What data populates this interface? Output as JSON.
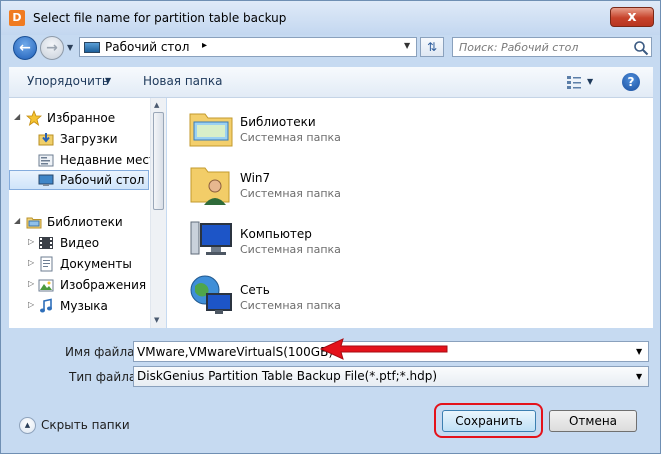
{
  "window": {
    "title": "Select file name for partition table backup",
    "close_glyph": "x",
    "app_icon_glyph": "D"
  },
  "address": {
    "path": "Рабочий стол",
    "chevron": "▸",
    "search_placeholder": "Поиск: Рабочий стол"
  },
  "toolbar": {
    "organize": "Упорядочить",
    "new_folder": "Новая папка",
    "help": "?"
  },
  "nav": {
    "favorites_group": "Избранное",
    "favorites": [
      {
        "label": "Загрузки",
        "icon": "downloads-icon"
      },
      {
        "label": "Недавние места",
        "icon": "recent-places-icon"
      },
      {
        "label": "Рабочий стол",
        "icon": "desktop-icon",
        "selected": true
      }
    ],
    "libraries_group": "Библиотеки",
    "libraries": [
      {
        "label": "Видео",
        "icon": "video-icon"
      },
      {
        "label": "Документы",
        "icon": "documents-icon"
      },
      {
        "label": "Изображения",
        "icon": "images-icon"
      },
      {
        "label": "Музыка",
        "icon": "music-icon"
      }
    ]
  },
  "files": [
    {
      "name": "Библиотеки",
      "type": "Системная папка",
      "icon": "libraries-folder-icon"
    },
    {
      "name": "Win7",
      "type": "Системная папка",
      "icon": "user-folder-icon"
    },
    {
      "name": "Компьютер",
      "type": "Системная папка",
      "icon": "computer-icon"
    },
    {
      "name": "Сеть",
      "type": "Системная папка",
      "icon": "network-icon"
    }
  ],
  "form": {
    "filename_label": "Имя файла:",
    "filename_value": "VMware,VMwareVirtualS(100GB)",
    "filetype_label": "Тип файла:",
    "filetype_value": "DiskGenius Partition Table Backup File(*.ptf;*.hdp)"
  },
  "footer": {
    "hide_folders": "Скрыть папки",
    "save": "Сохранить",
    "cancel": "Отмена"
  },
  "colors": {
    "accent": "#1f5fb8",
    "annotation": "#e4121b",
    "frame": "#c6daf1"
  }
}
